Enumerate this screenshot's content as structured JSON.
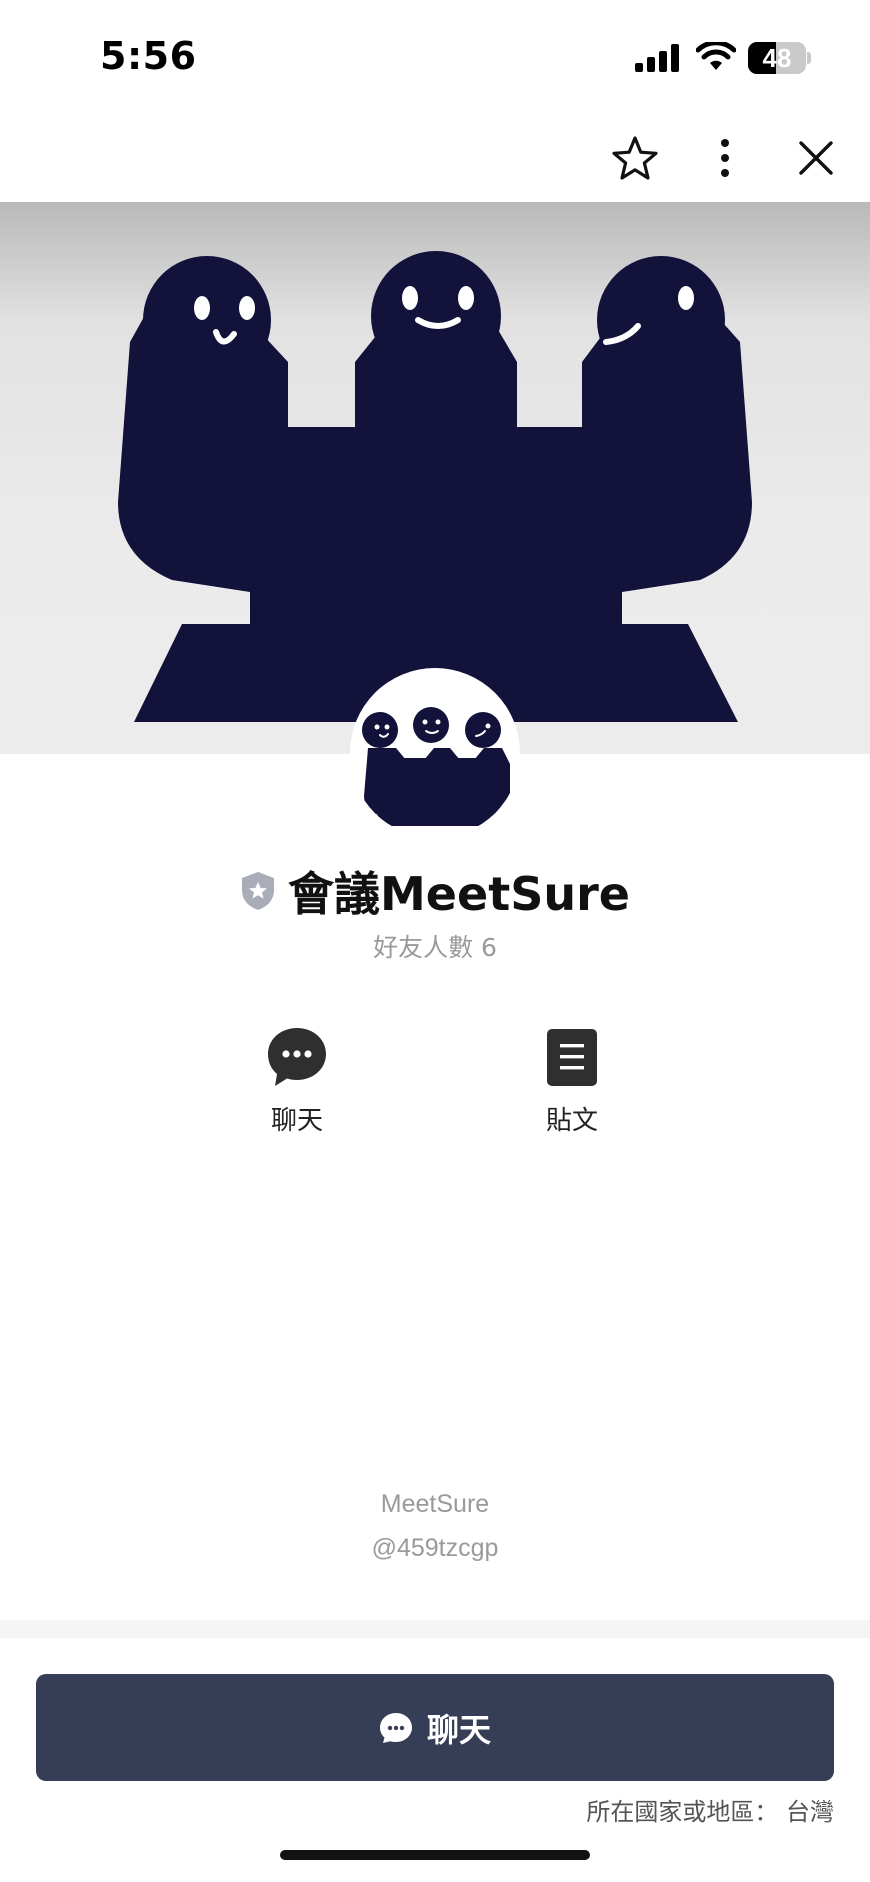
{
  "status_bar": {
    "time": "5:56",
    "battery_level": "48",
    "battery_fraction": 0.48
  },
  "nav": {
    "icons": [
      "star-icon",
      "more-vertical-icon",
      "close-icon"
    ]
  },
  "profile": {
    "name": "會議MeetSure",
    "friends_label": "好友人數 6",
    "badge_icon": "shield-star-icon"
  },
  "actions": [
    {
      "label": "聊天",
      "icon": "chat-bubble-icon"
    },
    {
      "label": "貼文",
      "icon": "document-icon"
    }
  ],
  "account": {
    "display_name": "MeetSure",
    "line_id": "@459tzcgp"
  },
  "cta": {
    "label": "聊天",
    "icon": "chat-bubble-icon"
  },
  "region_text": "所在國家或地區： 台灣",
  "colors": {
    "cta_background": "#363e57",
    "figure_navy": "#12123a",
    "muted_text": "#9a9a9a",
    "badge_gray": "#a9adb8"
  }
}
